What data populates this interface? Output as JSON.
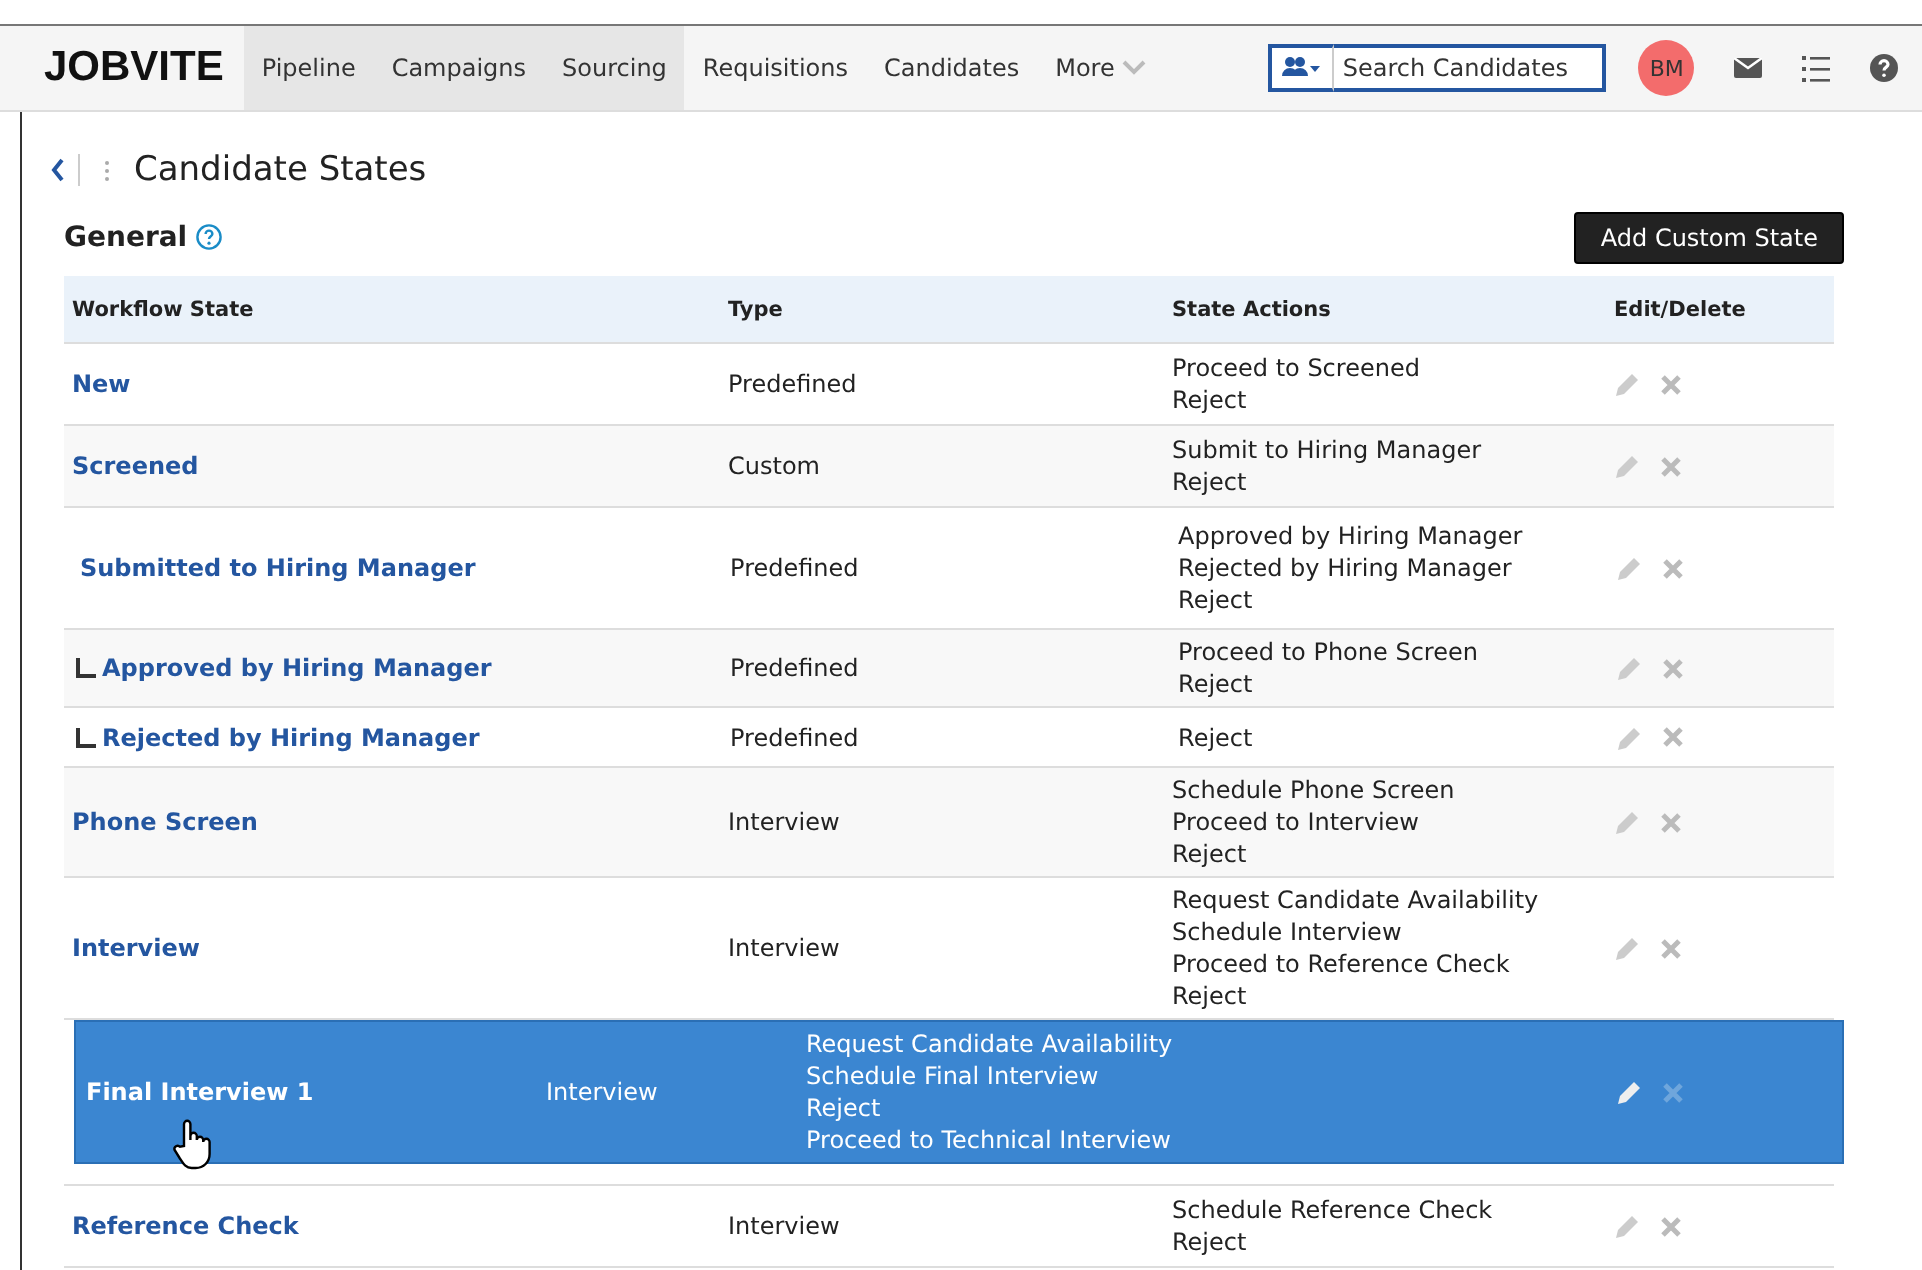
{
  "nav": {
    "logo": "JOBVITE",
    "items": [
      {
        "label": "Pipeline",
        "selected": true
      },
      {
        "label": "Campaigns",
        "selected": true
      },
      {
        "label": "Sourcing",
        "selected": true
      },
      {
        "label": "Requisitions",
        "selected": false
      },
      {
        "label": "Candidates",
        "selected": false
      },
      {
        "label": "More",
        "selected": false
      }
    ],
    "search": {
      "placeholder": "Search Candidates"
    },
    "avatar": "BM"
  },
  "page": {
    "title": "Candidate States",
    "section": "General",
    "add_button": "Add Custom State"
  },
  "table": {
    "columns": [
      "Workflow State",
      "Type",
      "State Actions",
      "Edit/Delete"
    ],
    "rows": [
      {
        "name": "New",
        "type": "Predefined",
        "actions": [
          "Proceed to Screened",
          "Reject"
        ]
      },
      {
        "name": "Screened",
        "type": "Custom",
        "actions": [
          "Submit to Hiring Manager",
          "Reject"
        ]
      },
      {
        "name": "Submitted to Hiring Manager",
        "type": "Predefined",
        "actions": [
          "Approved by Hiring Manager",
          "Rejected by Hiring Manager",
          "Reject"
        ],
        "children": [
          {
            "name": "Approved by Hiring Manager",
            "type": "Predefined",
            "actions": [
              "Proceed to Phone Screen",
              "Reject"
            ]
          },
          {
            "name": "Rejected by Hiring Manager",
            "type": "Predefined",
            "actions": [
              "Reject"
            ]
          }
        ]
      },
      {
        "name": "Phone Screen",
        "type": "Interview",
        "actions": [
          "Schedule Phone Screen",
          "Proceed to Interview",
          "Reject"
        ]
      },
      {
        "name": "Interview",
        "type": "Interview",
        "actions": [
          "Request Candidate Availability",
          "Schedule Interview",
          "Proceed to Reference Check",
          "Reject"
        ]
      },
      {
        "kind": "drop_slot"
      },
      {
        "name": "Reference Check",
        "type": "Interview",
        "actions": [
          "Schedule Reference Check",
          "Reject"
        ]
      }
    ],
    "dragged_row": {
      "name": "Final Interview 1",
      "type": "Interview",
      "actions": [
        "Request Candidate Availability",
        "Schedule Final Interview",
        "Reject",
        "Proceed to Technical Interview"
      ]
    }
  }
}
